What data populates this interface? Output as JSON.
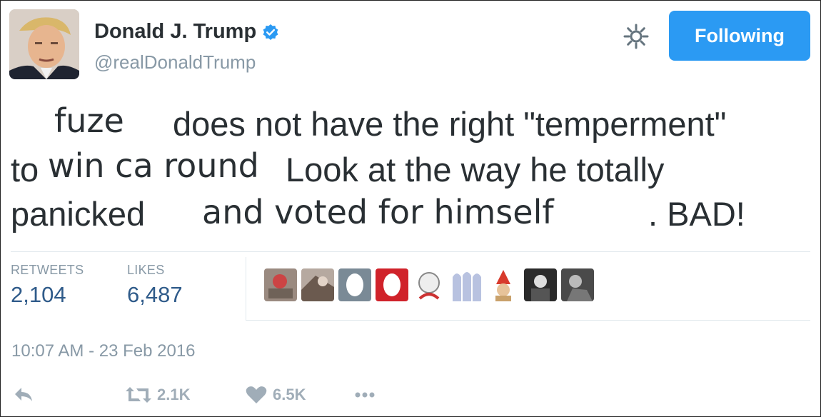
{
  "author": {
    "name": "Donald J. Trump",
    "handle": "@realDonaldTrump",
    "verified": true,
    "avatar_icon": "profile-photo"
  },
  "header": {
    "follow_button_label": "Following",
    "settings_icon": "gear-icon"
  },
  "tweet": {
    "segments": {
      "s1": "fuze",
      "s2": "does not have the right \"temperment\"",
      "s3": "to",
      "s4": "win ca round",
      "s5": "Look at the way he totally",
      "s6": "panicked",
      "s7": "and voted for himself",
      "s8": ". BAD!"
    }
  },
  "stats": {
    "retweets_label": "RETWEETS",
    "retweets_value": "2,104",
    "likes_label": "LIKES",
    "likes_value": "6,487"
  },
  "timestamp": "10:07 AM - 23 Feb 2016",
  "actions": {
    "reply_icon": "reply-icon",
    "retweet_icon": "retweet-icon",
    "retweet_count": "2.1K",
    "like_icon": "heart-icon",
    "like_count": "6.5K",
    "more_icon": "more-icon"
  },
  "colors": {
    "accent": "#2b9af3",
    "muted": "#8899a6",
    "stat_value": "#2f5b8a"
  }
}
